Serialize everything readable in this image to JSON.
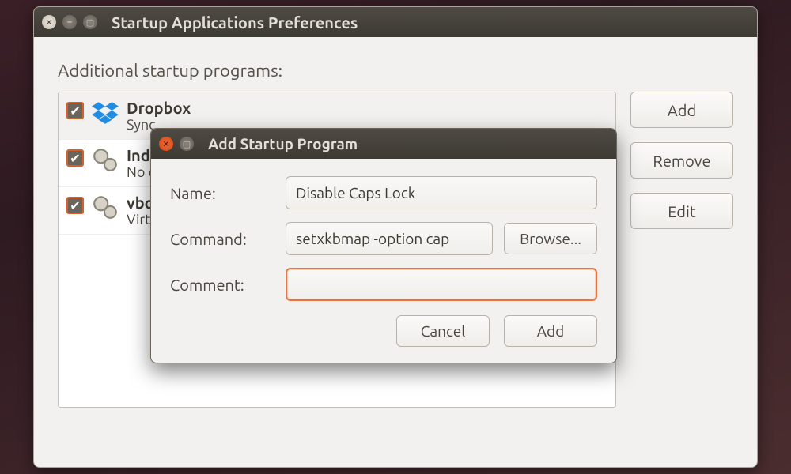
{
  "prefs": {
    "title": "Startup Applications Preferences",
    "section_label": "Additional startup programs:",
    "items": [
      {
        "checked": true,
        "icon": "dropbox-icon",
        "name": "Dropbox",
        "desc": "Sync"
      },
      {
        "checked": true,
        "icon": "gears-icon",
        "name": "Indic",
        "desc": "No d"
      },
      {
        "checked": true,
        "icon": "gears-icon",
        "name": "vbox",
        "desc": "Virtu"
      }
    ],
    "buttons": {
      "add": "Add",
      "remove": "Remove",
      "edit": "Edit"
    }
  },
  "dialog": {
    "title": "Add Startup Program",
    "fields": {
      "name_label": "Name:",
      "name_value": "Disable Caps Lock",
      "command_label": "Command:",
      "command_value": "setxkbmap -option cap",
      "browse": "Browse...",
      "comment_label": "Comment:",
      "comment_value": ""
    },
    "actions": {
      "cancel": "Cancel",
      "add": "Add"
    }
  },
  "glyphs": {
    "close": "✕",
    "min": "–",
    "max": "▢",
    "check": "✔"
  }
}
